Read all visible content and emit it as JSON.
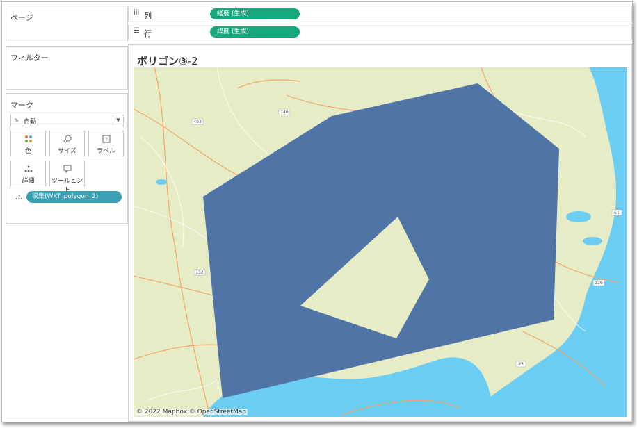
{
  "pages": {
    "title": "ページ"
  },
  "filters": {
    "title": "フィルター"
  },
  "marks": {
    "title": "マーク",
    "type": "自動",
    "buttons": {
      "color": "色",
      "size": "サイズ",
      "label": "ラベル",
      "detail": "詳細",
      "tooltip": "ツールヒント"
    },
    "field": "収集(WKT_polygon_2)"
  },
  "shelves": {
    "columns": {
      "label": "列",
      "pill": "経度 (生成)",
      "icon": "columns-icon"
    },
    "rows": {
      "label": "行",
      "pill": "緯度 (生成)",
      "icon": "rows-icon"
    }
  },
  "sheet": {
    "title_main": "ポリゴン③",
    "title_suffix": "-2"
  },
  "map": {
    "attribution": "© 2022 Mapbox © OpenStreetMap",
    "route_labels": [
      "146",
      "403",
      "152",
      "51",
      "126",
      "93"
    ],
    "colors": {
      "land": "#e6ecc6",
      "water": "#6bcdf2",
      "polygon": "#4f74a5",
      "road": "#f3a56b"
    }
  }
}
